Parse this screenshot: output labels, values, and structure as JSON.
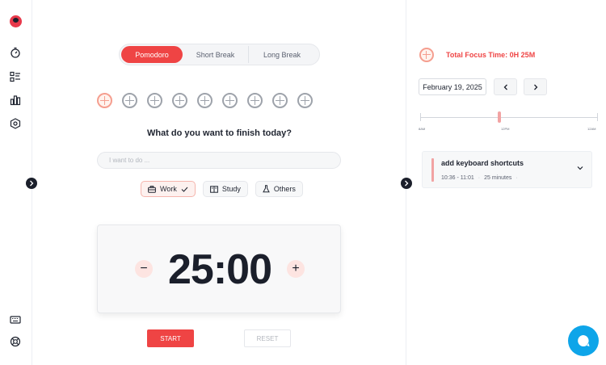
{
  "sidebar": {
    "items": [
      {
        "name": "timer-icon"
      },
      {
        "name": "task-list-icon"
      },
      {
        "name": "stats-icon"
      },
      {
        "name": "settings-icon"
      }
    ],
    "bottom": [
      {
        "name": "keyboard-icon"
      },
      {
        "name": "help-icon"
      }
    ]
  },
  "modes": {
    "pomodoro": "Pomodoro",
    "short_break": "Short Break",
    "long_break": "Long Break"
  },
  "sessions": {
    "total": 9,
    "completed": 0
  },
  "task": {
    "question": "What do you want to finish today?",
    "placeholder": "I want to do ..."
  },
  "categories": {
    "work": "Work",
    "study": "Study",
    "others": "Others"
  },
  "timer": {
    "display": "25:00",
    "minus": "−",
    "plus": "+"
  },
  "controls": {
    "start": "START",
    "reset": "RESET"
  },
  "panel": {
    "total_focus": "Total Focus Time: 0H 25M",
    "date": "February 19, 2025",
    "timeline": {
      "start": "8AM",
      "mid": "12PM",
      "end": "12AM"
    },
    "session": {
      "title": "add keyboard shortcuts",
      "time_range": "10:36 - 11:01",
      "duration": "25 minutes"
    }
  },
  "colors": {
    "accent": "#ef4444",
    "chat": "#0ea5e9",
    "dark": "#1b1f2b"
  }
}
